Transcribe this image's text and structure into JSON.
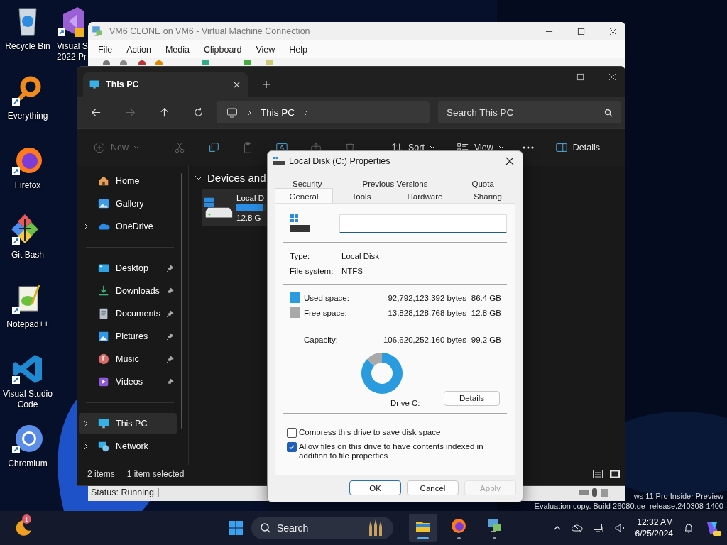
{
  "desktop_icons": [
    {
      "label": "Recycle Bin",
      "kind": "recycle"
    },
    {
      "label": "Everything",
      "kind": "everything"
    },
    {
      "label": "Firefox",
      "kind": "firefox"
    },
    {
      "label": "Git Bash",
      "kind": "git"
    },
    {
      "label": "Notepad++",
      "kind": "notepad"
    },
    {
      "label": "Visual Studio\nCode",
      "kind": "vscode"
    },
    {
      "label": "Chromium",
      "kind": "chromium"
    }
  ],
  "desktop_icons_column_2": [
    {
      "label": "Visual S\n2022 Pr",
      "kind": "vs"
    }
  ],
  "vm_window": {
    "title": "VM6 CLONE on VM6 - Virtual Machine Connection",
    "menu": [
      "File",
      "Action",
      "Media",
      "Clipboard",
      "View",
      "Help"
    ],
    "status": "Status: Running"
  },
  "explorer": {
    "tab": {
      "title": "This PC"
    },
    "breadcrumb": [
      "This PC"
    ],
    "search": {
      "placeholder": "Search This PC"
    },
    "commands": [
      {
        "kind": "new",
        "label": "New",
        "disabled": true
      },
      {
        "kind": "cut",
        "disabled": true
      },
      {
        "kind": "copy",
        "disabled": false
      },
      {
        "kind": "paste",
        "disabled": true
      },
      {
        "kind": "rename",
        "disabled": false
      },
      {
        "kind": "share",
        "disabled": true
      },
      {
        "kind": "delete",
        "disabled": true
      },
      {
        "kind": "sort",
        "label": "Sort",
        "disabled": false
      },
      {
        "kind": "view",
        "label": "View",
        "disabled": false
      },
      {
        "kind": "more",
        "disabled": false
      }
    ],
    "details_button": "Details",
    "sidebar": [
      {
        "items": [
          {
            "label": "Home",
            "kind": "home",
            "expandable": false,
            "pinned": false,
            "selected": false
          },
          {
            "label": "Gallery",
            "kind": "gallery",
            "expandable": false,
            "pinned": false,
            "selected": false
          },
          {
            "label": "OneDrive",
            "kind": "onedrive",
            "expandable": true,
            "pinned": false,
            "selected": false
          }
        ]
      },
      {
        "items": [
          {
            "label": "Desktop",
            "kind": "desktop",
            "expandable": false,
            "pinned": true,
            "selected": false
          },
          {
            "label": "Downloads",
            "kind": "downloads",
            "expandable": false,
            "pinned": true,
            "selected": false
          },
          {
            "label": "Documents",
            "kind": "documents",
            "expandable": false,
            "pinned": true,
            "selected": false
          },
          {
            "label": "Pictures",
            "kind": "pictures",
            "expandable": false,
            "pinned": true,
            "selected": false
          },
          {
            "label": "Music",
            "kind": "music",
            "expandable": false,
            "pinned": true,
            "selected": false
          },
          {
            "label": "Videos",
            "kind": "videos",
            "expandable": false,
            "pinned": true,
            "selected": false
          }
        ]
      },
      {
        "items": [
          {
            "label": "This PC",
            "kind": "thispc",
            "expandable": true,
            "pinned": false,
            "selected": true
          },
          {
            "label": "Network",
            "kind": "network",
            "expandable": true,
            "pinned": false,
            "selected": false
          }
        ]
      }
    ],
    "section": "Devices and",
    "drive": {
      "name": "Local D",
      "free": "12.8 G",
      "level": 0.87
    },
    "status": [
      "2 items",
      "1 item selected"
    ]
  },
  "dialog": {
    "title": "Local Disk (C:) Properties",
    "tab_rows": [
      [
        {
          "label": "Security",
          "selected": false
        },
        {
          "label": "Previous Versions",
          "selected": false
        },
        {
          "label": "Quota",
          "selected": false
        }
      ],
      [
        {
          "label": "General",
          "selected": true
        },
        {
          "label": "Tools",
          "selected": false
        },
        {
          "label": "Hardware",
          "selected": false
        },
        {
          "label": "Sharing",
          "selected": false
        }
      ]
    ],
    "info": [
      {
        "label": "Type:",
        "value": "Local Disk"
      },
      {
        "label": "File system:",
        "value": "NTFS"
      }
    ],
    "space": [
      {
        "label": "Used space:",
        "bytes": "92,792,123,392 bytes",
        "size": "86.4 GB",
        "color": "#2b9be0"
      },
      {
        "label": "Free space:",
        "bytes": "13,828,128,768 bytes",
        "size": "12.8 GB",
        "color": "#a9a9a9"
      }
    ],
    "capacity": {
      "label": "Capacity:",
      "bytes": "106,620,252,160 bytes",
      "size": "99.2 GB"
    },
    "chart_data": {
      "type": "donut",
      "values": [
        86.4,
        12.8
      ]
    },
    "drive_label": "Drive C:",
    "details_button": "Details",
    "checkboxes": [
      {
        "label": "Compress this drive to save disk space",
        "checked": false
      },
      {
        "label": "Allow files on this drive to have contents indexed in addition to file properties",
        "checked": true
      }
    ],
    "buttons": [
      {
        "label": "OK",
        "default": true,
        "disabled": false
      },
      {
        "label": "Cancel",
        "default": false,
        "disabled": false
      },
      {
        "label": "Apply",
        "default": false,
        "disabled": true
      }
    ]
  },
  "os_notice": [
    "ws 11 Pro Insider Preview",
    "Evaluation copy. Build 26080.ge_release.240308-1400"
  ],
  "taskbar": {
    "weather_badge": "1",
    "search": {
      "placeholder": "Search"
    },
    "apps": [
      {
        "kind": "explorer",
        "selected": true
      },
      {
        "kind": "firefox",
        "selected": false
      },
      {
        "kind": "vmconnect",
        "selected": false
      }
    ],
    "time": "12:32 AM",
    "date": "6/25/2024"
  }
}
